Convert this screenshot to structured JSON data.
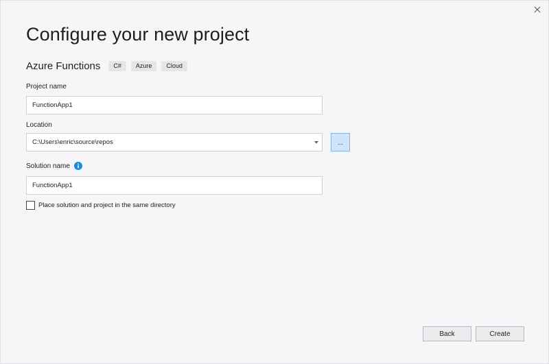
{
  "dialog": {
    "title": "Configure your new project",
    "template_name": "Azure Functions",
    "tags": [
      "C#",
      "Azure",
      "Cloud"
    ]
  },
  "project_name": {
    "label": "Project name",
    "value": "FunctionApp1"
  },
  "location": {
    "label": "Location",
    "value": "C:\\Users\\enric\\source\\repos",
    "browse_label": "..."
  },
  "solution_name": {
    "label": "Solution name",
    "value": "FunctionApp1",
    "info_icon": "info-icon"
  },
  "same_directory": {
    "label": "Place solution and project in the same directory",
    "checked": false
  },
  "buttons": {
    "back": "Back",
    "create": "Create"
  },
  "colors": {
    "background": "#f6f6f8",
    "info_blue": "#1c8ce0",
    "browse_bg": "#cfe4fa",
    "browse_border": "#7eb4ea"
  }
}
